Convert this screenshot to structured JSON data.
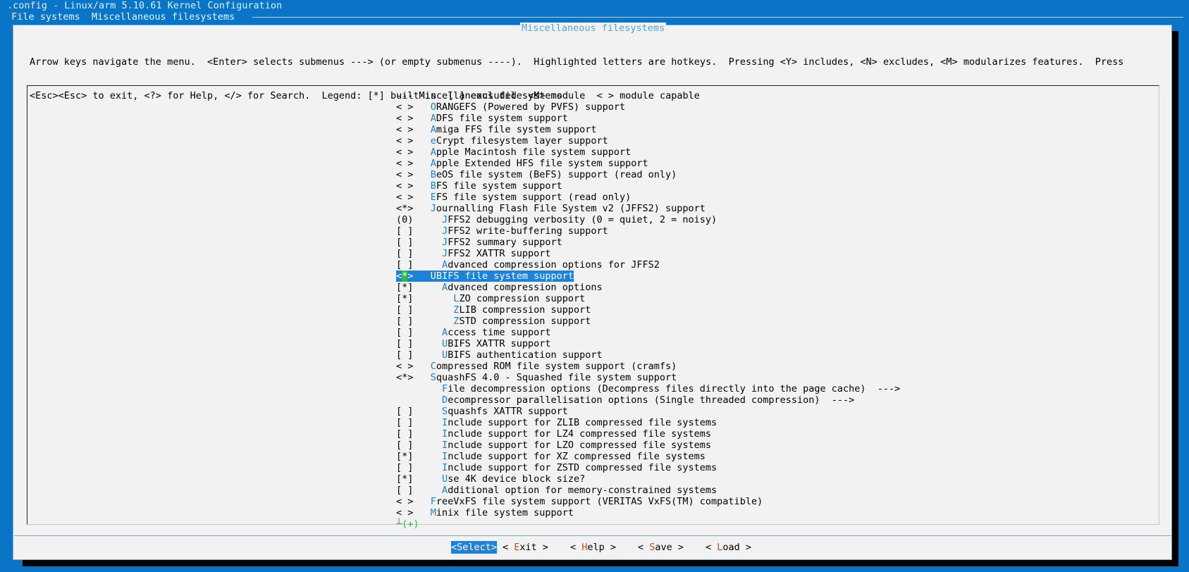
{
  "window_title": ".config - Linux/arm 5.10.61 Kernel Configuration",
  "breadcrumbs": [
    "File systems",
    "Miscellaneous filesystems"
  ],
  "breadcrumb_separator": "  ",
  "dialog_title": "Miscellaneous filesystems",
  "help_lines": [
    "Arrow keys navigate the menu.  <Enter> selects submenus ---> (or empty submenus ----).  Highlighted letters are hotkeys.  Pressing <Y> includes, <N> excludes, <M> modularizes features.  Press",
    "<Esc><Esc> to exit, <?> for Help, </> for Search.  Legend: [*] built-in  [ ] excluded  <M> module  < > module capable"
  ],
  "menu_items": [
    {
      "prefix": "--- ",
      "pad": "",
      "hot": "",
      "rest": "Miscellaneous filesystems"
    },
    {
      "prefix": "< >   ",
      "pad": "",
      "hot": "O",
      "rest": "RANGEFS (Powered by PVFS) support"
    },
    {
      "prefix": "< >   ",
      "pad": "",
      "hot": "A",
      "rest": "DFS file system support"
    },
    {
      "prefix": "< >   ",
      "pad": "",
      "hot": "A",
      "rest": "miga FFS file system support"
    },
    {
      "prefix": "< >   ",
      "pad": "",
      "hot": "e",
      "rest": "Crypt filesystem layer support"
    },
    {
      "prefix": "< >   ",
      "pad": "",
      "hot": "A",
      "rest": "pple Macintosh file system support"
    },
    {
      "prefix": "< >   ",
      "pad": "",
      "hot": "A",
      "rest": "pple Extended HFS file system support"
    },
    {
      "prefix": "< >   ",
      "pad": "",
      "hot": "B",
      "rest": "eOS file system (BeFS) support (read only)"
    },
    {
      "prefix": "< >   ",
      "pad": "",
      "hot": "B",
      "rest": "FS file system support"
    },
    {
      "prefix": "< >   ",
      "pad": "",
      "hot": "E",
      "rest": "FS file system support (read only)"
    },
    {
      "prefix": "<*>   ",
      "pad": "",
      "hot": "J",
      "rest": "ournalling Flash File System v2 (JFFS2) support"
    },
    {
      "prefix": "(0)   ",
      "pad": "  ",
      "hot": "J",
      "rest": "FFS2 debugging verbosity (0 = quiet, 2 = noisy)"
    },
    {
      "prefix": "[ ]   ",
      "pad": "  ",
      "hot": "J",
      "rest": "FFS2 write-buffering support"
    },
    {
      "prefix": "[ ]   ",
      "pad": "  ",
      "hot": "J",
      "rest": "FFS2 summary support"
    },
    {
      "prefix": "[ ]   ",
      "pad": "  ",
      "hot": "J",
      "rest": "FFS2 XATTR support"
    },
    {
      "prefix": "[ ]   ",
      "pad": "  ",
      "hot": "A",
      "rest": "dvanced compression options for JFFS2"
    },
    {
      "prefix": "<*>   ",
      "pad": "",
      "hot": "U",
      "rest": "BIFS file system support",
      "selected": true
    },
    {
      "prefix": "[*]   ",
      "pad": "  ",
      "hot": "A",
      "rest": "dvanced compression options"
    },
    {
      "prefix": "[*]   ",
      "pad": "    ",
      "hot": "L",
      "rest": "ZO compression support"
    },
    {
      "prefix": "[ ]   ",
      "pad": "    ",
      "hot": "Z",
      "rest": "LIB compression support"
    },
    {
      "prefix": "[ ]   ",
      "pad": "    ",
      "hot": "Z",
      "rest": "STD compression support"
    },
    {
      "prefix": "[ ]   ",
      "pad": "  ",
      "hot": "A",
      "rest": "ccess time support"
    },
    {
      "prefix": "[ ]   ",
      "pad": "  ",
      "hot": "U",
      "rest": "BIFS XATTR support"
    },
    {
      "prefix": "[ ]   ",
      "pad": "  ",
      "hot": "U",
      "rest": "BIFS authentication support"
    },
    {
      "prefix": "< >   ",
      "pad": "",
      "hot": "C",
      "rest": "ompressed ROM file system support (cramfs)"
    },
    {
      "prefix": "<*>   ",
      "pad": "",
      "hot": "S",
      "rest": "quashFS 4.0 - Squashed file system support"
    },
    {
      "prefix": "      ",
      "pad": "  ",
      "hot": "F",
      "rest": "ile decompression options (Decompress files directly into the page cache)  --->"
    },
    {
      "prefix": "      ",
      "pad": "  ",
      "hot": "D",
      "rest": "ecompressor parallelisation options (Single threaded compression)  --->"
    },
    {
      "prefix": "[ ]   ",
      "pad": "  ",
      "hot": "S",
      "rest": "quashfs XATTR support"
    },
    {
      "prefix": "[ ]   ",
      "pad": "  ",
      "hot": "I",
      "rest": "nclude support for ZLIB compressed file systems"
    },
    {
      "prefix": "[ ]   ",
      "pad": "  ",
      "hot": "I",
      "rest": "nclude support for LZ4 compressed file systems"
    },
    {
      "prefix": "[ ]   ",
      "pad": "  ",
      "hot": "I",
      "rest": "nclude support for LZO compressed file systems"
    },
    {
      "prefix": "[*]   ",
      "pad": "  ",
      "hot": "I",
      "rest": "nclude support for XZ compressed file systems"
    },
    {
      "prefix": "[ ]   ",
      "pad": "  ",
      "hot": "I",
      "rest": "nclude support for ZSTD compressed file systems"
    },
    {
      "prefix": "[*]   ",
      "pad": "  ",
      "hot": "U",
      "rest": "se 4K device block size?"
    },
    {
      "prefix": "[ ]   ",
      "pad": "  ",
      "hot": "A",
      "rest": "dditional option for memory-constrained systems"
    },
    {
      "prefix": "< >   ",
      "pad": "",
      "hot": "F",
      "rest": "reeVxFS file system support (VERITAS VxFS(TM) compatible)"
    },
    {
      "prefix": "< >   ",
      "pad": "",
      "hot": "M",
      "rest": "inix file system support"
    }
  ],
  "more_indicator": "┴(+)",
  "buttons": [
    {
      "open": "<",
      "hot": "S",
      "rest": "elect",
      "close": ">",
      "active": true
    },
    {
      "open": "< ",
      "hot": "E",
      "rest": "xit",
      "close": " >"
    },
    {
      "open": "< ",
      "hot": "H",
      "rest": "elp",
      "close": " >"
    },
    {
      "open": "< ",
      "hot": "S",
      "rest": "ave",
      "close": " >"
    },
    {
      "open": "< ",
      "hot": "L",
      "rest": "oad",
      "close": " >"
    }
  ],
  "colors": {
    "background": "#0a74c6",
    "dialog": "#f2f2f2",
    "selection": "#1e82d8",
    "hotkey": "#1e7fd0",
    "button_hotkey": "#d04a1a",
    "cursor": "#28c33a"
  }
}
